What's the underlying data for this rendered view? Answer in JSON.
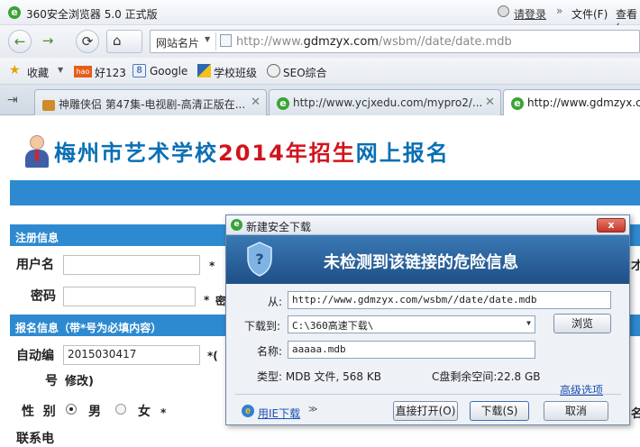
{
  "titlebar": {
    "app_title": "360安全浏览器 5.0 正式版",
    "login": "请登录",
    "more": "»",
    "menu_file": "文件(F)",
    "menu_view": "查看("
  },
  "nav": {
    "back": "←",
    "forward": "→",
    "refresh": "⟳",
    "home": "⌂",
    "site_dropdown": "网站名片",
    "url_prefix": "http://www.",
    "url_domain": "gdmzyx.com",
    "url_path": "/wsbm//date/date.mdb"
  },
  "favorites": {
    "bookmarks": "收藏",
    "items": [
      "好123",
      "Google",
      "学校班级",
      "SEO综合"
    ]
  },
  "tabs": [
    {
      "title": "神雕侠侣 第47集-电视剧-高清正版在..."
    },
    {
      "title": "http://www.ycjxedu.com/mypro2/..."
    },
    {
      "title": "http://www.gdmzyx.com/"
    }
  ],
  "page": {
    "title_blue": "梅州市艺术学校",
    "title_red": "2014年招生",
    "title_tail": "网上报名",
    "section_register": "注册信息",
    "label_username": "用户名",
    "label_password": "密码",
    "required": "*",
    "password_hint_fragment": "密",
    "section_apply": "报名信息（带*号为必填内容）",
    "label_autonum_1": "自动编",
    "label_autonum_2": "号",
    "autonum_value": "2015030417",
    "autonum_note_1": "*(",
    "autonum_note_2": "修改)",
    "label_gender": "性  别",
    "gender_male": "男",
    "gender_female": "女",
    "label_contact": "联系电",
    "right_fragment_1": "才",
    "right_fragment_2": "名"
  },
  "dialog": {
    "title": "新建安全下载",
    "close": "x",
    "banner": "未检测到该链接的危险信息",
    "from_label": "从:",
    "from_value": "http://www.gdmzyx.com/wsbm//date/date.mdb",
    "saveto_label": "下载到:",
    "saveto_value": "C:\\360高速下载\\",
    "browse": "浏览",
    "name_label": "名称:",
    "name_value": "aaaaa.mdb",
    "type_text": "类型: MDB 文件, 568 KB",
    "free_space": "C盘剩余空间:22.8 GB",
    "advanced": "高级选项",
    "use_ie": "用IE下载",
    "open_direct": "直接打开(O)",
    "download": "下载(S)",
    "cancel": "取消"
  }
}
